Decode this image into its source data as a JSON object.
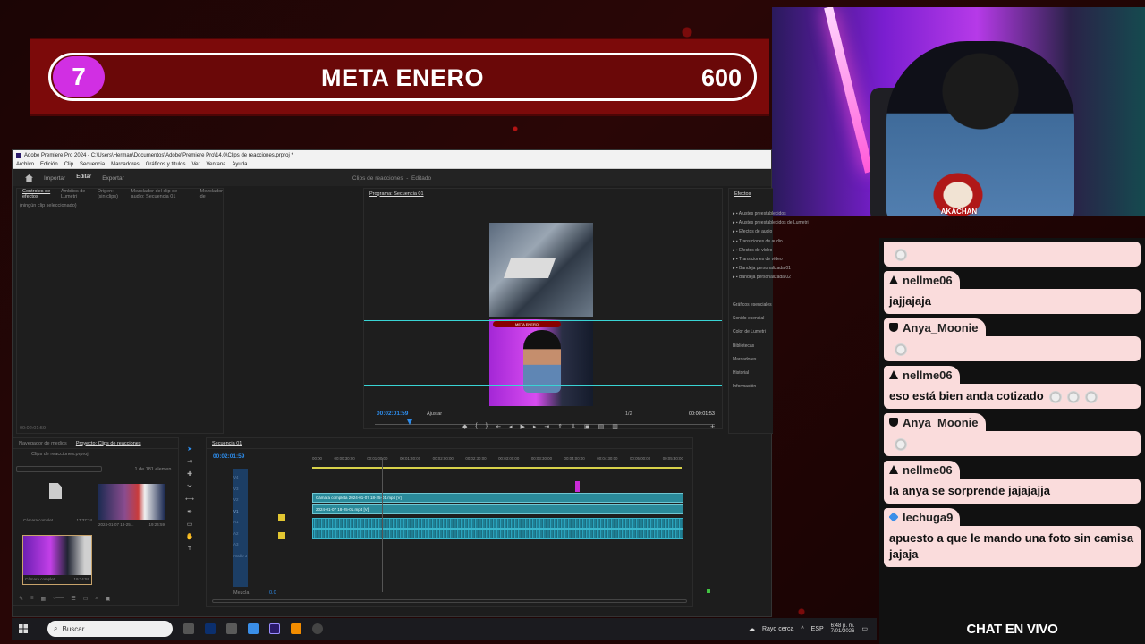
{
  "goal": {
    "number": "7",
    "title": "META ENERO",
    "target": "600"
  },
  "webcam": {
    "logo_text": "AKACHAN"
  },
  "premiere": {
    "title": "Adobe Premiere Pro 2024 - C:\\Users\\Herman\\Documentos\\Adobe\\Premiere Pro\\14.0\\Clips de reacciones.prproj *",
    "menus": [
      "Archivo",
      "Edición",
      "Clip",
      "Secuencia",
      "Marcadores",
      "Gráficos y títulos",
      "Ver",
      "Ventana",
      "Ayuda"
    ],
    "workspace_tabs": [
      "Importar",
      "Editar",
      "Exportar"
    ],
    "project_title": "Clips de reacciones",
    "project_status": "Editado",
    "source_tabs": [
      "Controles de efectos",
      "Ámbitos de Lumetri",
      "Origen: (sin clips)",
      "Mezclador del clip de audio: Secuencia 01",
      "Mezclador de"
    ],
    "no_clip": "(ningún clip seleccionado)",
    "source_tc": "00:02:01:59",
    "program_tab": "Programa: Secuencia 01",
    "program_tc": "00:02:01:59",
    "fit_label": "Ajustar",
    "resolution": "1/2",
    "duration": "00:00:01:53",
    "effects_tab": "Efectos",
    "effects_folders": [
      "Ajustes preestablecidos",
      "Ajustes preestablecidos de Lumetri",
      "Efectos de audio",
      "Transiciones de audio",
      "Efectos de vídeo",
      "Transiciones de vídeo",
      "Bandeja personalizada 01",
      "Bandeja personalizada 02"
    ],
    "effects_panels": [
      "Gráficos esenciales",
      "Sonido esencial",
      "Color de Lumetri",
      "Bibliotecas",
      "Marcadores",
      "Historial",
      "Información"
    ],
    "project_tabs": [
      "Navegador de medios",
      "Proyecto: Clips de reacciones"
    ],
    "project_file": "Clips de reacciones.prproj",
    "items_count": "1 de 181 elemen...",
    "bin_items": [
      {
        "name": "Cámara complet...",
        "dur": "17:37:34"
      },
      {
        "name": "2024-01-07 18-25...",
        "dur": "19:24:59"
      },
      {
        "name": "Cámara complet...",
        "dur": "19:24:59"
      }
    ],
    "sequence_tab": "Secuencia 01",
    "timeline_tc": "00:02:01:59",
    "ruler_labels": [
      "00:00",
      "00:00:30:00",
      "00:01:00:00",
      "00:01:30:00",
      "00:02:00:00",
      "00:02:30:00",
      "00:03:00:00",
      "00:03:30:00",
      "00:04:00:00",
      "00:04:30:00",
      "00:05:00:00",
      "00:05:30:00"
    ],
    "tracks": [
      "V4",
      "V3",
      "V2",
      "V1",
      "A1",
      "A2",
      "A3",
      "Audio 3",
      "Mezcla"
    ],
    "clip_v2": "Cámara completa 2024-01-07 18-25-01.mp4 [V]",
    "clip_v1": "2024-01-07 18-25-01.mp4 [V]",
    "mix_value": "0.0"
  },
  "chat": {
    "messages": [
      {
        "user": "",
        "badge": "none",
        "text": "",
        "emotes": 1
      },
      {
        "user": "nellme06",
        "badge": "mod",
        "text": "jajjajaja",
        "emotes": 0
      },
      {
        "user": "Anya_Moonie",
        "badge": "shield",
        "text": "",
        "emotes": 1
      },
      {
        "user": "nellme06",
        "badge": "mod",
        "text": "eso está bien anda cotizado",
        "emotes": 3
      },
      {
        "user": "Anya_Moonie",
        "badge": "shield",
        "text": "",
        "emotes": 1
      },
      {
        "user": "nellme06",
        "badge": "mod",
        "text": "la anya se sorprende jajajajja",
        "emotes": 0
      },
      {
        "user": "lechuga9",
        "badge": "gem",
        "text": "apuesto a que le mando una foto sin camisa jajaja",
        "emotes": 0
      }
    ],
    "footer": "CHAT EN VIVO"
  },
  "taskbar": {
    "search_placeholder": "Buscar",
    "weather": "Rayo cerca",
    "lang": "ESP",
    "time": "6:48 p. m.",
    "date": "7/01/2026"
  }
}
